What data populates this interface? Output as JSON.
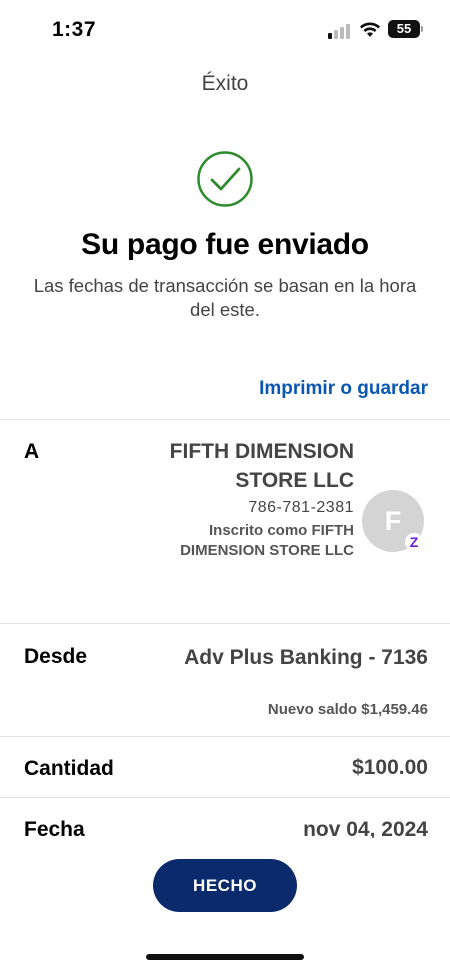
{
  "status_bar": {
    "time": "1:37",
    "battery": "55"
  },
  "header": {
    "title": "Éxito"
  },
  "confirmation": {
    "headline": "Su pago fue enviado",
    "subtext": "Las fechas de transacción se basan en la hora del este."
  },
  "actions": {
    "print_label": "Imprimir o guardar",
    "done_label": "HECHO"
  },
  "details": {
    "to": {
      "label": "A",
      "name": "FIFTH DIMENSION STORE LLC",
      "phone": "786-781-2381",
      "enrolled": "Inscrito como FIFTH DIMENSION STORE LLC",
      "avatar_letter": "F",
      "zelle_glyph": "Z"
    },
    "from": {
      "label": "Desde",
      "account": "Adv Plus Banking - 7136",
      "balance": "Nuevo saldo $1,459.46"
    },
    "amount": {
      "label": "Cantidad",
      "value": "$100.00"
    },
    "date": {
      "label": "Fecha",
      "value": "nov 04, 2024"
    }
  },
  "colors": {
    "link": "#0a57b3",
    "button": "#0a2a6b",
    "success": "#2e8b2e",
    "zelle": "#6d1ed4"
  }
}
